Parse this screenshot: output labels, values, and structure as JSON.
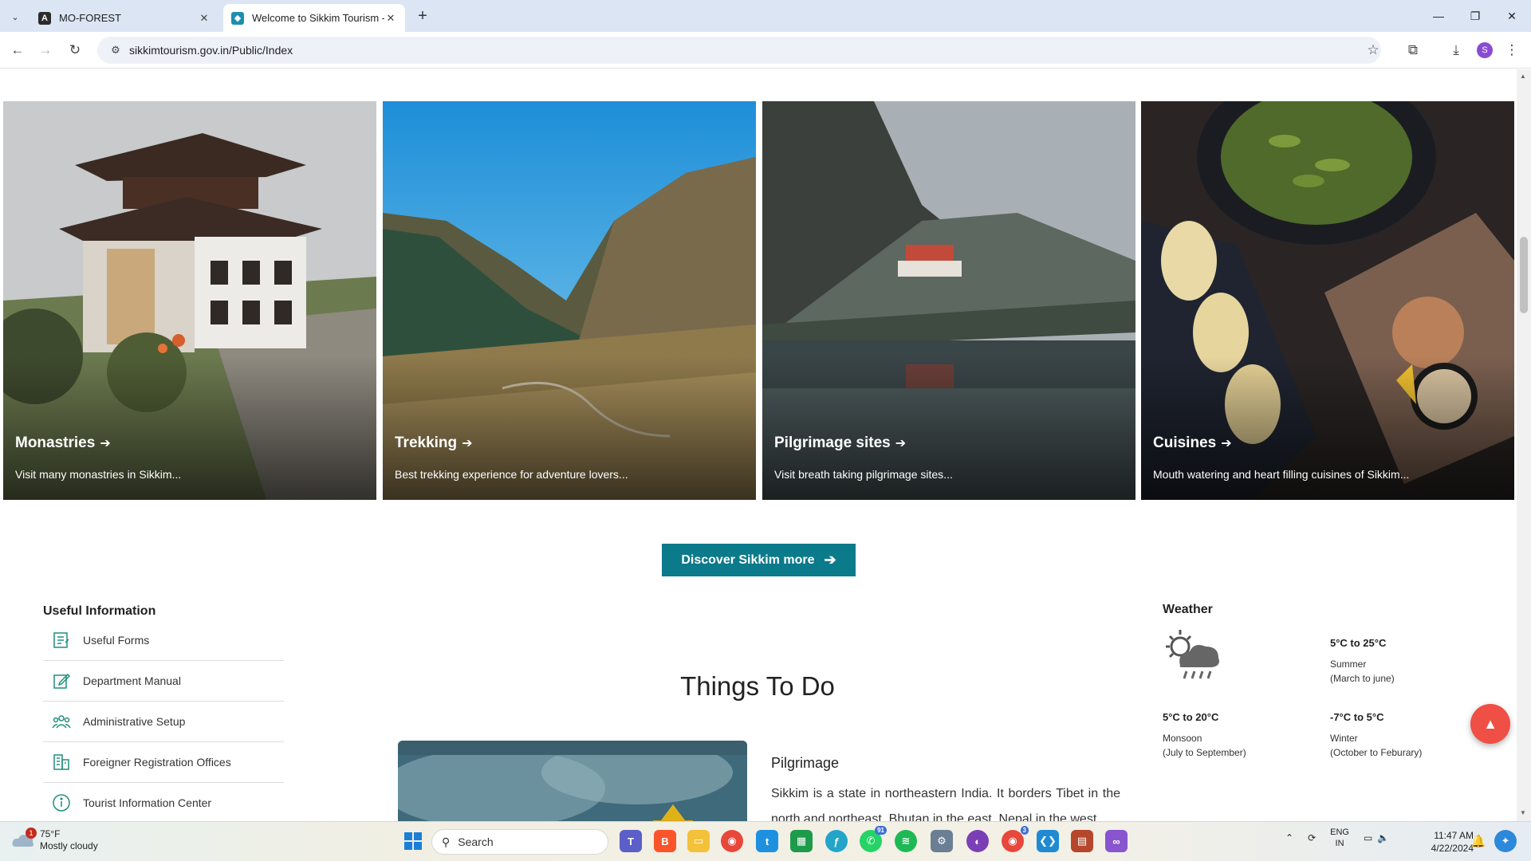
{
  "browser": {
    "tabs": [
      {
        "title": "MO-FOREST",
        "active": false
      },
      {
        "title": "Welcome to Sikkim Tourism - ",
        "active": true
      }
    ],
    "url": "sikkimtourism.gov.in/Public/Index",
    "profile_initial": "S"
  },
  "cards": [
    {
      "title": "Monastries",
      "desc": "Visit many monastries in Sikkim..."
    },
    {
      "title": "Trekking",
      "desc": "Best trekking experience for adventure lovers..."
    },
    {
      "title": "Pilgrimage sites",
      "desc": "Visit breath taking pilgrimage sites..."
    },
    {
      "title": "Cuisines",
      "desc": "Mouth watering and heart filling cuisines of Sikkim..."
    }
  ],
  "discover_label": "Discover Sikkim more",
  "useful": {
    "title": "Useful Information",
    "items": [
      {
        "label": "Useful Forms"
      },
      {
        "label": "Department Manual"
      },
      {
        "label": "Administrative Setup"
      },
      {
        "label": "Foreigner Registration Offices"
      },
      {
        "label": "Tourist Information Center"
      }
    ]
  },
  "things": {
    "title": "Things To Do",
    "item_title": "Pilgrimage",
    "item_text": "Sikkim is a state in northeastern India. It borders Tibet in the north and northeast, Bhutan in the east, Nepal in the west,"
  },
  "weather": {
    "title": "Weather",
    "seasons": [
      {
        "temp": "5°C to 25°C",
        "name": "Summer",
        "months": "(March to june)"
      },
      {
        "temp": "5°C to 20°C",
        "name": "Monsoon",
        "months": "(July to September)"
      },
      {
        "temp": "-7°C to 5°C",
        "name": "Winter",
        "months": "(October to Feburary)"
      }
    ]
  },
  "taskbar": {
    "weather_temp": "75°F",
    "weather_desc": "Mostly cloudy",
    "weather_badge": "1",
    "search_placeholder": "Search",
    "whatsapp_badge": "91",
    "chrome_badge": "3",
    "lang_line1": "ENG",
    "lang_line2": "IN",
    "time": "11:47 AM",
    "date": "4/22/2024"
  }
}
